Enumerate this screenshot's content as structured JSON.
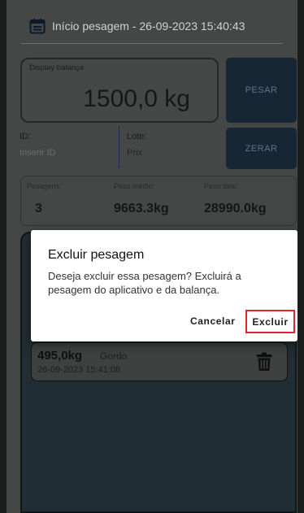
{
  "header": {
    "title": "Início pesagem - 26-09-2023 15:40:43",
    "icon": "calendar-icon"
  },
  "display": {
    "label": "Display balança",
    "value": "1500,0 kg"
  },
  "buttons": {
    "pesar": "PESAR",
    "zerar": "ZERAR"
  },
  "identity": {
    "id_label": "ID:",
    "id_placeholder": "Inserir ID",
    "lote_label": "Lote:",
    "lote_value": "Prix"
  },
  "stats": {
    "pesagens_label": "Pesagens:",
    "pesagens_value": "3",
    "peso_medio_label": "Peso médio:",
    "peso_medio_value": "9663.3kg",
    "peso_total_label": "Peso total:",
    "peso_total_value": "28990.0kg"
  },
  "list": {
    "items": [
      {
        "weight": "495,0kg",
        "tag": "Gordo",
        "datetime": "26-09-2023 15:41:08",
        "icon": "trash-icon"
      }
    ]
  },
  "dialog": {
    "title": "Excluir pesagem",
    "message": "Deseja excluir essa pesagem? Excluirá a pesagem do aplicativo e da balança.",
    "cancel_label": "Cancelar",
    "confirm_label": "Excluir"
  },
  "colors": {
    "highlight": "#e0252b",
    "button_dark": "#172634",
    "panel": "#212d34"
  }
}
